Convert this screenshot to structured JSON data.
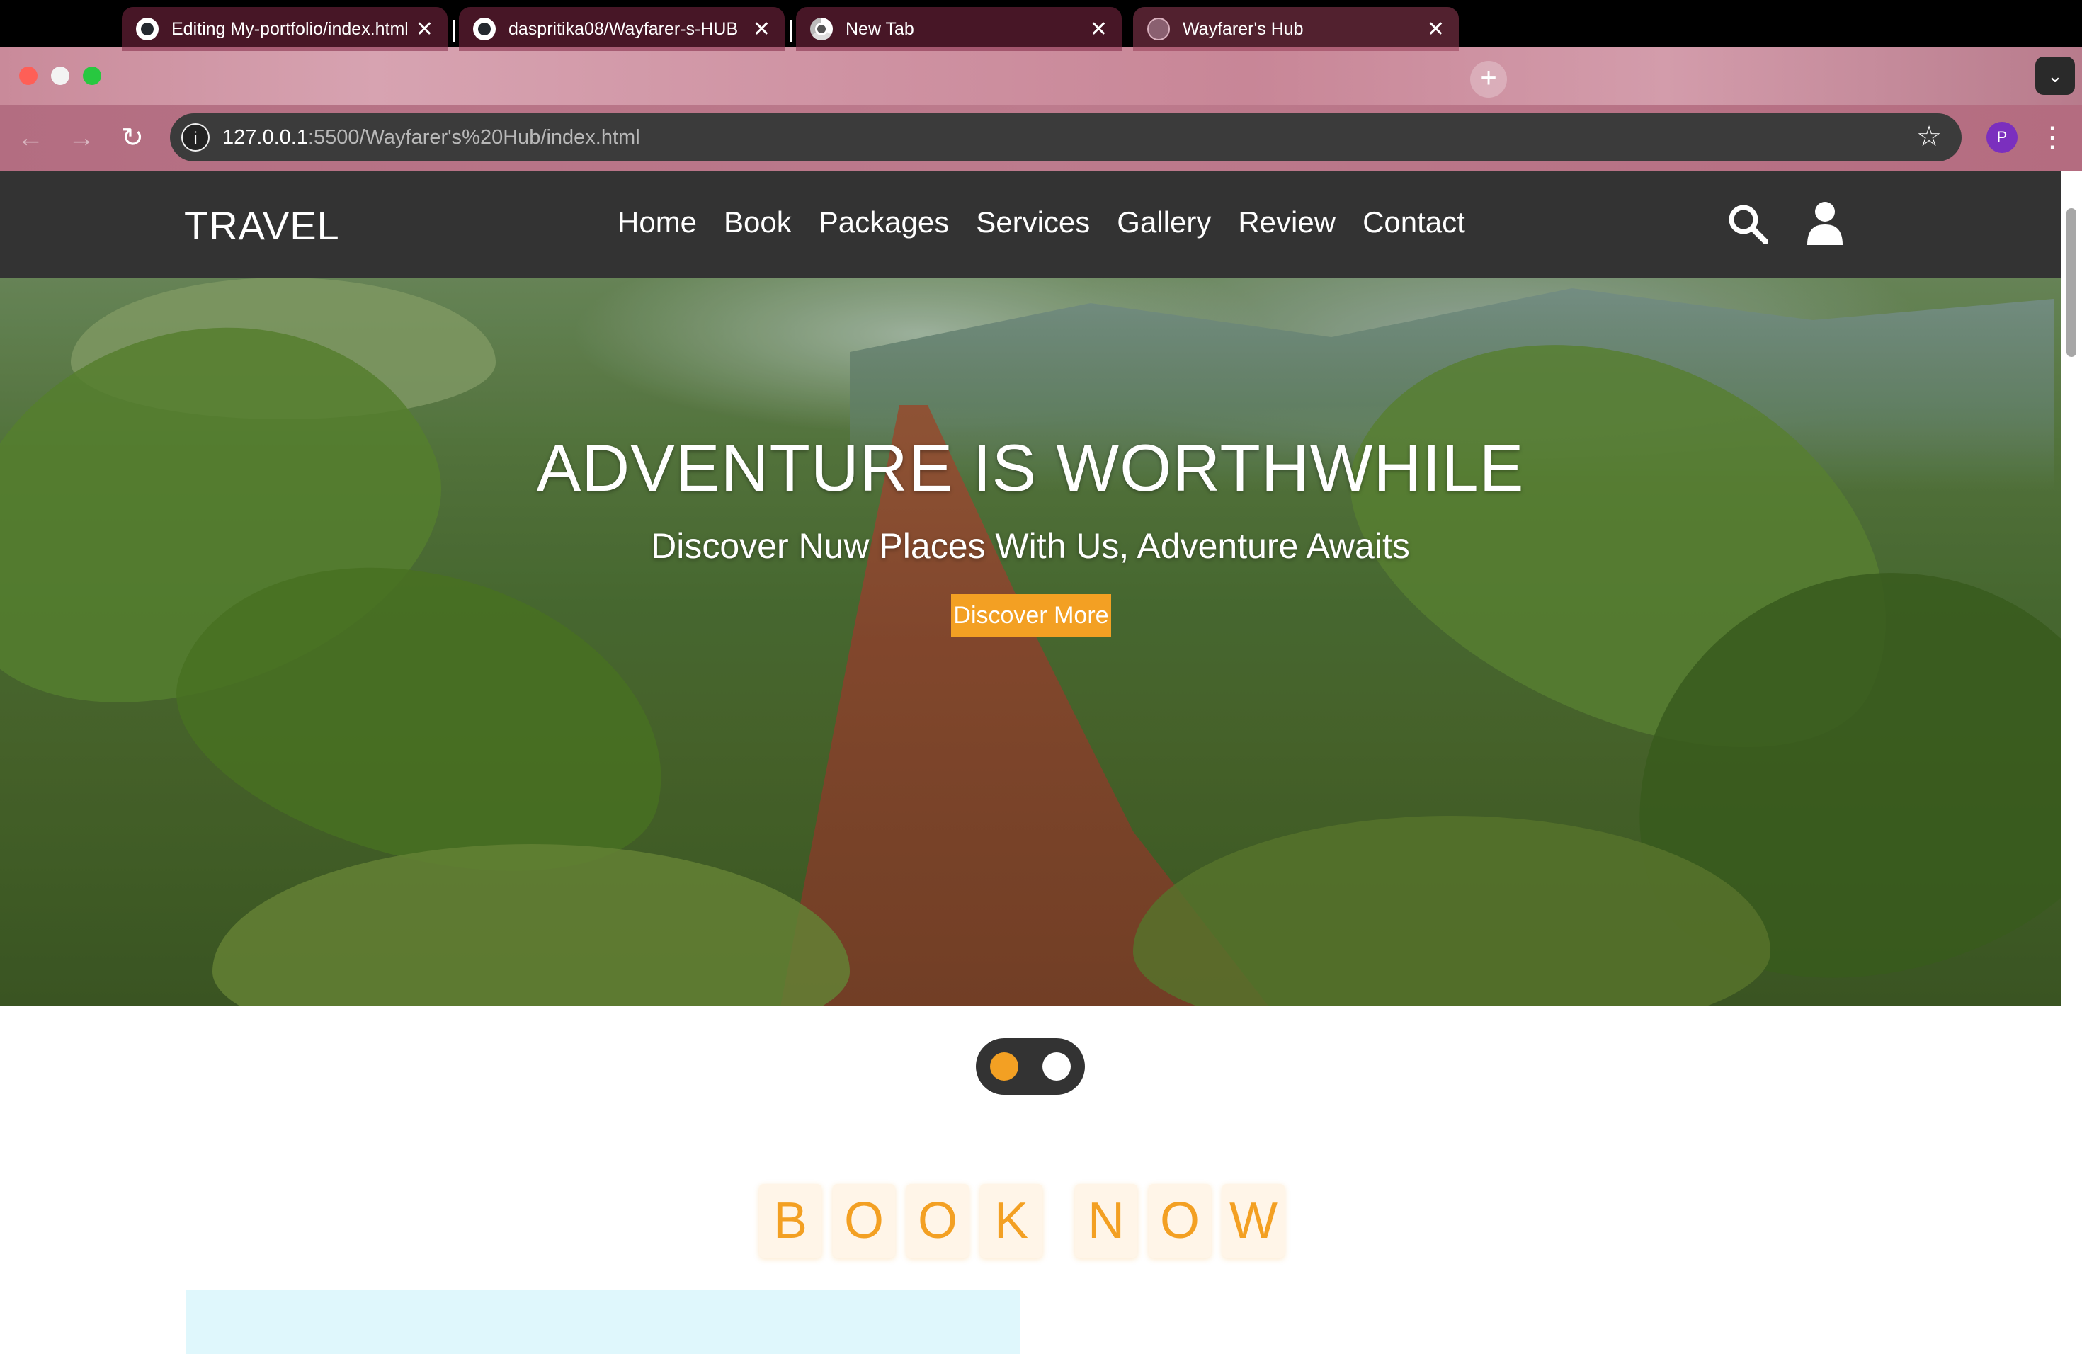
{
  "browser": {
    "tabs": [
      {
        "title": "Editing My-portfolio/index.html",
        "icon": "github-icon"
      },
      {
        "title": "daspritika08/Wayfarer-s-HUB",
        "icon": "github-icon"
      },
      {
        "title": "New Tab",
        "icon": "chrome-icon"
      },
      {
        "title": "Wayfarer's Hub",
        "icon": "globe-icon",
        "active": true
      }
    ],
    "url_host": "127.0.0.1",
    "url_rest": ":5500/Wayfarer's%20Hub/index.html",
    "profile_initial": "P"
  },
  "site": {
    "logo": "TRAVEL",
    "nav": [
      "Home",
      "Book",
      "Packages",
      "Services",
      "Gallery",
      "Review",
      "Contact"
    ],
    "hero": {
      "title": "ADVENTURE IS WORTHWHILE",
      "subtitle": "Discover Nuw Places With Us, Adventure Awaits",
      "button": "Discover More"
    },
    "book_heading_words": [
      [
        "B",
        "O",
        "O",
        "K"
      ],
      [
        "N",
        "O",
        "W"
      ]
    ],
    "colors": {
      "accent": "#f3a023",
      "header_bg": "#333333",
      "booking_bg": "#dff7fc"
    }
  }
}
